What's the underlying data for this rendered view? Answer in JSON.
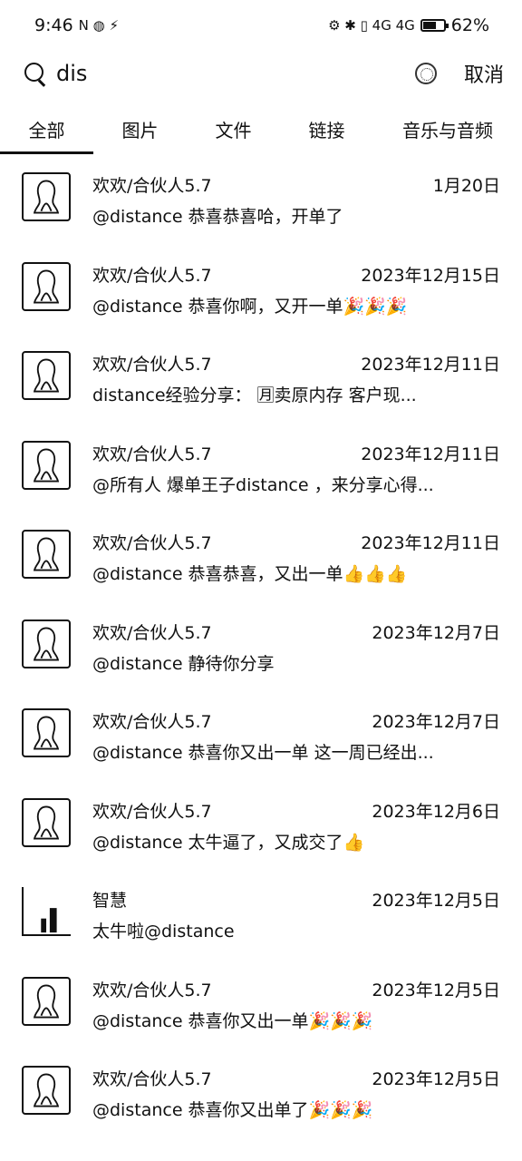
{
  "status": {
    "time": "9:46",
    "left_icons": "N ◍ ⚡",
    "right_icons": "⚙ ✱ ▯ 4G 4G",
    "battery_percent": "62%",
    "battery_level": 0.62
  },
  "search": {
    "query": "dis",
    "cancel_label": "取消"
  },
  "tabs": [
    {
      "label": "全部",
      "active": true
    },
    {
      "label": "图片",
      "active": false
    },
    {
      "label": "文件",
      "active": false
    },
    {
      "label": "链接",
      "active": false
    },
    {
      "label": "音乐与音频",
      "active": false
    }
  ],
  "results": [
    {
      "sender": "欢欢/合伙人5.7",
      "date": "1月20日",
      "message": "@distance 恭喜恭喜哈，开单了"
    },
    {
      "sender": "欢欢/合伙人5.7",
      "date": "2023年12月15日",
      "message": "@distance 恭喜你啊，又开一单🎉🎉🎉"
    },
    {
      "sender": "欢欢/合伙人5.7",
      "date": "2023年12月11日",
      "message": "distance经验分享： 🈷卖原内存 客户现..."
    },
    {
      "sender": "欢欢/合伙人5.7",
      "date": "2023年12月11日",
      "message": "@所有人 爆单王子distance ，来分享心得..."
    },
    {
      "sender": "欢欢/合伙人5.7",
      "date": "2023年12月11日",
      "message": "@distance 恭喜恭喜，又出一单👍👍👍"
    },
    {
      "sender": "欢欢/合伙人5.7",
      "date": "2023年12月7日",
      "message": "@distance 静待你分享"
    },
    {
      "sender": "欢欢/合伙人5.7",
      "date": "2023年12月7日",
      "message": "@distance 恭喜你又出一单 这一周已经出..."
    },
    {
      "sender": "欢欢/合伙人5.7",
      "date": "2023年12月6日",
      "message": "@distance 太牛逼了，又成交了👍"
    },
    {
      "sender": "智慧",
      "date": "2023年12月5日",
      "message": "太牛啦@distance"
    },
    {
      "sender": "欢欢/合伙人5.7",
      "date": "2023年12月5日",
      "message": "@distance 恭喜你又出一单🎉🎉🎉"
    },
    {
      "sender": "欢欢/合伙人5.7",
      "date": "2023年12月5日",
      "message": "@distance 恭喜你又出单了🎉🎉🎉"
    }
  ]
}
